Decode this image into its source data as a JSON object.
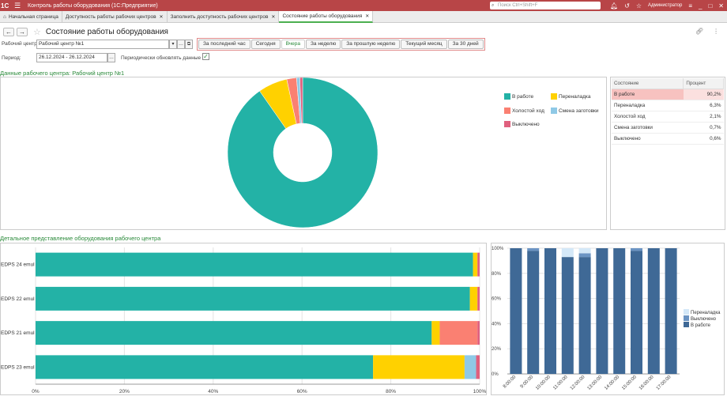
{
  "titlebar": {
    "logo": "1С",
    "app_title": "Контроль работы оборудования  (1С:Предприятие)",
    "search_placeholder": "Поиск Ctrl+Shift+F",
    "user": "Администратор",
    "color": "#b84547"
  },
  "tabs": [
    {
      "label": "Начальная страница"
    },
    {
      "label": "Доступность работы рабочих центров"
    },
    {
      "label": "Заполнить доступность рабочих центров"
    },
    {
      "label": "Состояние работы оборудования"
    }
  ],
  "page": {
    "title": "Состояние работы оборудования"
  },
  "form": {
    "workcenter_label": "Рабочий центр:",
    "workcenter_value": "Рабочий центр №1",
    "period_label": "Период:",
    "period_value": "26.12.2024 - 26.12.2024",
    "autorefresh_label": "Периодически обновлять данные",
    "autorefresh_checked": true
  },
  "period_buttons": [
    "За последний час",
    "Сегодня",
    "Вчера",
    "За неделю",
    "За прошлую неделю",
    "Текущий месяц",
    "За 30 дней"
  ],
  "period_selected": "Вчера",
  "sections": {
    "workcenter_data": "Данные рабочего центра: Рабочий центр №1",
    "detail": "Детальное представление оборудования рабочего центра"
  },
  "colors": {
    "work": "#23b2a6",
    "setup": "#ffd100",
    "idle": "#fa8072",
    "change": "#8fc9e6",
    "off": "#e0607e",
    "accent_green": "#2a8a3a",
    "col_work": "#3f6996",
    "col_off": "#6b94c3",
    "col_setup": "#d4e8f8"
  },
  "state_table": {
    "headers": [
      "Состояние",
      "Процент"
    ],
    "rows": [
      {
        "state": "В работе",
        "percent": "90,2%"
      },
      {
        "state": "Переналадка",
        "percent": "6,3%"
      },
      {
        "state": "Холостой ход",
        "percent": "2,1%"
      },
      {
        "state": "Смена заготовки",
        "percent": "0,7%"
      },
      {
        "state": "Выключено",
        "percent": "0,6%"
      }
    ]
  },
  "chart_data": [
    {
      "type": "pie",
      "style": "donut",
      "categories": [
        "В работе",
        "Переналадка",
        "Холостой ход",
        "Смена заготовки",
        "Выключено"
      ],
      "values": [
        90.2,
        6.3,
        2.1,
        0.7,
        0.6
      ],
      "legend": "right"
    },
    {
      "type": "bar",
      "orientation": "horizontal",
      "stacked": true,
      "categories": [
        "EDPS 24 emul",
        "EDPS 22 emul",
        "EDPS 21 emul",
        "EDPS 23 emul"
      ],
      "series": [
        {
          "name": "В работе",
          "values": [
            98.5,
            97.8,
            89.2,
            76.0
          ]
        },
        {
          "name": "Переналадка",
          "values": [
            1.0,
            1.7,
            1.8,
            20.6
          ]
        },
        {
          "name": "Холостой ход",
          "values": [
            0,
            0,
            8.5,
            0
          ]
        },
        {
          "name": "Смена заготовки",
          "values": [
            0,
            0,
            0,
            2.6
          ]
        },
        {
          "name": "Выключено",
          "values": [
            0.5,
            0.5,
            0.5,
            0.8
          ]
        }
      ],
      "xticks": [
        "0%",
        "20%",
        "40%",
        "60%",
        "80%",
        "100%"
      ],
      "xlim": [
        0,
        100
      ],
      "grid": true
    },
    {
      "type": "bar",
      "orientation": "vertical",
      "stacked": true,
      "categories": [
        "8:00:00",
        "9:00:00",
        "10:00:00",
        "11:00:00",
        "12:00:00",
        "13:00:00",
        "14:00:00",
        "15:00:00",
        "16:00:00",
        "17:00:00"
      ],
      "series": [
        {
          "name": "В работе",
          "values": [
            100,
            98,
            100,
            93,
            93,
            100,
            100,
            98,
            100,
            100
          ]
        },
        {
          "name": "Выключено",
          "values": [
            0,
            2,
            0,
            0,
            3,
            0,
            0,
            2,
            0,
            0
          ]
        },
        {
          "name": "Переналадка",
          "values": [
            0,
            0,
            0,
            7,
            4,
            0,
            0,
            0,
            0,
            0
          ]
        }
      ],
      "yticks": [
        "0%",
        "20%",
        "40%",
        "60%",
        "80%",
        "100%"
      ],
      "ylim": [
        0,
        100
      ],
      "legend": "right",
      "grid": true
    }
  ]
}
